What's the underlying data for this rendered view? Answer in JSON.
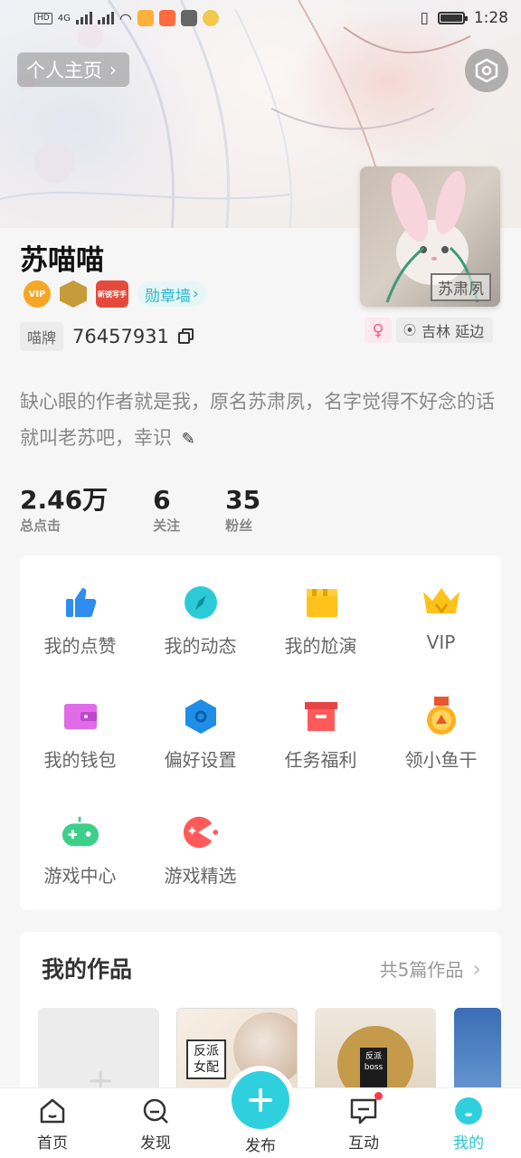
{
  "status_bar": {
    "time": "1:28",
    "network": "4G",
    "chips": [
      "HD",
      "HD"
    ]
  },
  "header": {
    "profile_link": "个人主页",
    "settings_icon": "hexagon-settings-icon"
  },
  "profile": {
    "username": "苏喵喵",
    "avatar_watermark": "苏肃夙",
    "badges": [
      "VIP",
      "",
      "新锐写手"
    ],
    "medal_wall": "勋章墙",
    "id_label": "喵牌",
    "id_number": "76457931",
    "gender_symbol": "♀",
    "location": "吉林 延边",
    "bio": "缺心眼的作者就是我，原名苏肃夙，名字觉得不好念的话就叫老苏吧，幸识"
  },
  "stats": [
    {
      "value": "2.46万",
      "label": "总点击"
    },
    {
      "value": "6",
      "label": "关注"
    },
    {
      "value": "35",
      "label": "粉丝"
    }
  ],
  "functions": [
    {
      "label": "我的点赞",
      "icon": "thumbs-up-icon",
      "color": "#2f8cf0"
    },
    {
      "label": "我的动态",
      "icon": "compass-icon",
      "color": "#2ccad6"
    },
    {
      "label": "我的尬演",
      "icon": "clapperboard-icon",
      "color": "#ffc21a"
    },
    {
      "label": "VIP",
      "icon": "crown-icon",
      "color": "#ffc21a"
    },
    {
      "label": "我的钱包",
      "icon": "wallet-icon",
      "color": "#e06be8"
    },
    {
      "label": "偏好设置",
      "icon": "hexagon-icon",
      "color": "#1f8ee8"
    },
    {
      "label": "任务福利",
      "icon": "gift-box-icon",
      "color": "#ff5a5a"
    },
    {
      "label": "领小鱼干",
      "icon": "medal-icon",
      "color": "#ffb020"
    },
    {
      "label": "游戏中心",
      "icon": "gamepad-icon",
      "color": "#3dcf8a"
    },
    {
      "label": "游戏精选",
      "icon": "pacman-icon",
      "color": "#ff5a5a"
    }
  ],
  "works": {
    "title": "我的作品",
    "count_label": "共5篇作品",
    "covers": [
      {
        "text": ""
      },
      {
        "text": "反派女配"
      },
      {
        "text": "反派boss"
      },
      {
        "text": ""
      }
    ]
  },
  "bottom_nav": {
    "home": "首页",
    "discover": "发现",
    "publish": "发布",
    "interact": "互动",
    "mine": "我的"
  }
}
